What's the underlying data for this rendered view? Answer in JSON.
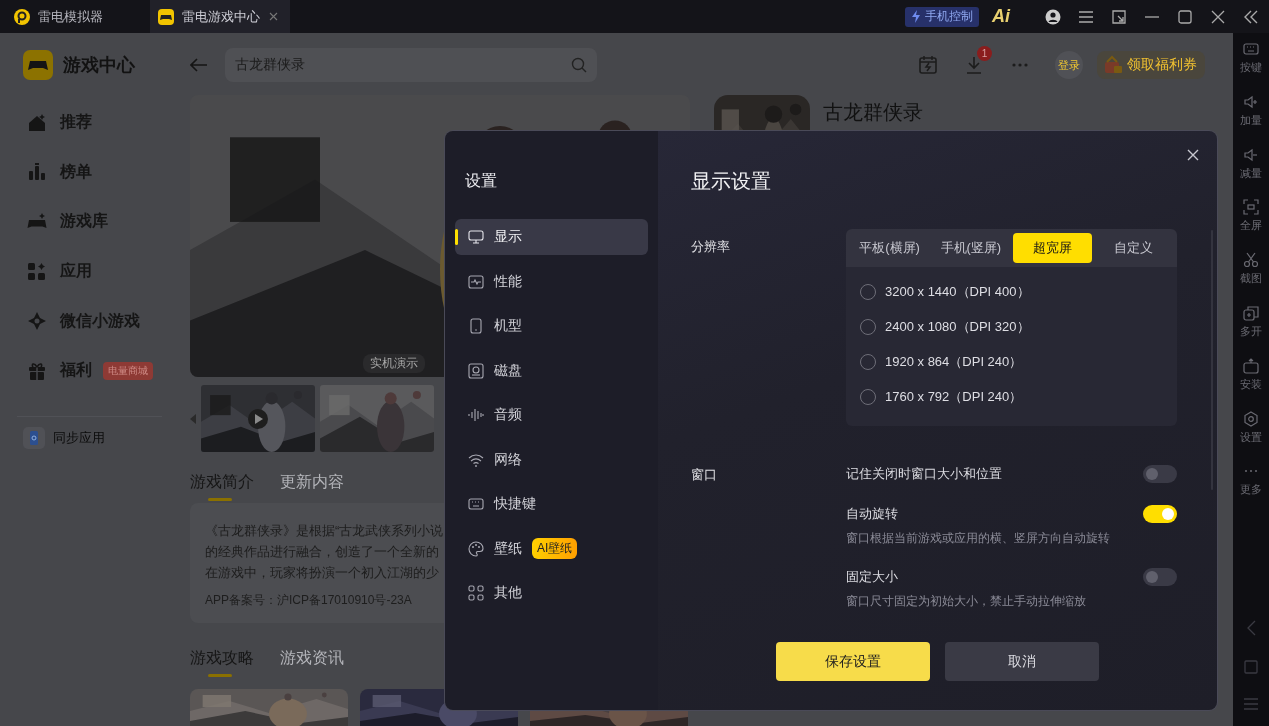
{
  "titlebar": {
    "tabs": [
      {
        "label": "雷电模拟器",
        "selected": false,
        "closable": false
      },
      {
        "label": "雷电游戏中心",
        "selected": true,
        "closable": true
      }
    ],
    "phone_control": "手机控制",
    "ai_logo": "Ai"
  },
  "sidebar": {
    "title": "游戏中心",
    "items": [
      {
        "label": "推荐"
      },
      {
        "label": "榜单"
      },
      {
        "label": "游戏库"
      },
      {
        "label": "应用"
      },
      {
        "label": "微信小游戏"
      },
      {
        "label": "福利",
        "badge": "电量商城"
      }
    ],
    "sync": "同步应用"
  },
  "header": {
    "search": {
      "value": "古龙群侠录"
    },
    "download_badge": "1",
    "login": "登录",
    "coupon": "领取福利券"
  },
  "banner": {
    "caption": "实机演示"
  },
  "game": {
    "title": "古龙群侠录"
  },
  "intro_tabs": [
    {
      "label": "游戏简介",
      "selected": true
    },
    {
      "label": "更新内容",
      "selected": false
    }
  ],
  "description": {
    "lines": [
      "《古龙群侠录》是根据“古龙武侠系列小说",
      "的经典作品进行融合，创造了一个全新的",
      "在游戏中，玩家将扮演一个初入江湖的少"
    ],
    "record": "APP备案号：沪ICP备17010910号-23A"
  },
  "guide_tabs": [
    {
      "label": "游戏攻略",
      "selected": true
    },
    {
      "label": "游戏资讯",
      "selected": false
    }
  ],
  "toolbar": {
    "items": [
      {
        "label": "按键"
      },
      {
        "label": "加量"
      },
      {
        "label": "减量"
      },
      {
        "label": "全屏"
      },
      {
        "label": "截图"
      },
      {
        "label": "多开"
      },
      {
        "label": "安装"
      },
      {
        "label": "设置"
      },
      {
        "label": "更多"
      }
    ]
  },
  "dialog": {
    "title": "设置",
    "nav": [
      {
        "label": "显示",
        "selected": true
      },
      {
        "label": "性能",
        "selected": false
      },
      {
        "label": "机型",
        "selected": false
      },
      {
        "label": "磁盘",
        "selected": false
      },
      {
        "label": "音频",
        "selected": false
      },
      {
        "label": "网络",
        "selected": false
      },
      {
        "label": "快捷键",
        "selected": false
      },
      {
        "label": "壁纸",
        "selected": false,
        "badge": "AI壁纸"
      },
      {
        "label": "其他",
        "selected": false
      }
    ],
    "heading": "显示设置",
    "resolution": {
      "label": "分辨率",
      "modes": [
        {
          "label": "平板(横屏)",
          "selected": false
        },
        {
          "label": "手机(竖屏)",
          "selected": false
        },
        {
          "label": "超宽屏",
          "selected": true
        },
        {
          "label": "自定义",
          "selected": false
        }
      ],
      "options": [
        {
          "label": "3200 x 1440（DPI 400）",
          "selected": false
        },
        {
          "label": "2400 x 1080（DPI 320）",
          "selected": false
        },
        {
          "label": "1920 x 864（DPI 240）",
          "selected": false
        },
        {
          "label": "1760 x 792（DPI 240）",
          "selected": false
        }
      ]
    },
    "window": {
      "label": "窗口",
      "settings": [
        {
          "label": "记住关闭时窗口大小和位置",
          "on": false
        },
        {
          "label": "自动旋转",
          "on": true,
          "description": "窗口根据当前游戏或应用的横、竖屏方向自动旋转"
        },
        {
          "label": "固定大小",
          "on": false,
          "description": "窗口尺寸固定为初始大小，禁止手动拉伸缩放"
        }
      ]
    },
    "buttons": [
      {
        "label": "保存设置",
        "kind": "primary"
      },
      {
        "label": "取消",
        "kind": "secondary"
      }
    ]
  }
}
